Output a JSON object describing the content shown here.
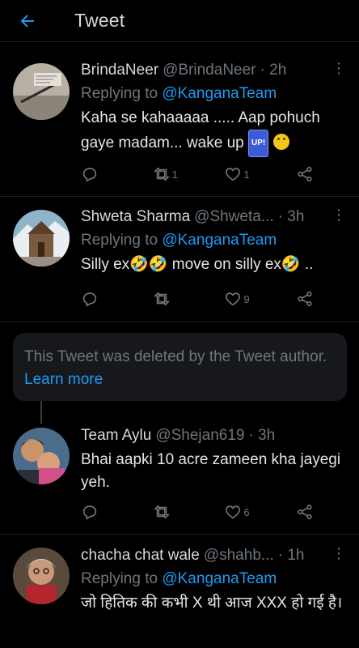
{
  "header": {
    "title": "Tweet"
  },
  "tweets": [
    {
      "name": "BrindaNeer",
      "handle": "@BrindaNeer",
      "time": "· 2h",
      "replying_prefix": "Replying to ",
      "replying_handle": "@KanganaTeam",
      "text": "Kaha se kahaaaaa ..... Aap pohuch gaye madam... wake up",
      "emoji_up": "UP!",
      "reply_count": "",
      "retweet_count": "1",
      "like_count": "1"
    },
    {
      "name": "Shweta Sharma",
      "handle": "@Shweta...",
      "time": "· 3h",
      "replying_prefix": "Replying to ",
      "replying_handle": "@KanganaTeam",
      "text": "Silly ex🤣🤣  move on silly ex🤣 ..",
      "reply_count": "",
      "retweet_count": "",
      "like_count": "9"
    },
    {
      "name": "Team Aylu",
      "handle": "@Shejan619",
      "time": "· 3h",
      "text": "Bhai aapki 10 acre zameen kha jayegi yeh.",
      "reply_count": "",
      "retweet_count": "",
      "like_count": "6"
    },
    {
      "name": "chacha chat wale",
      "handle": "@shahb...",
      "time": "· 1h",
      "replying_prefix": "Replying to ",
      "replying_handle": "@KanganaTeam",
      "text": "जो हितिक की कभी X थी आज XXX हो गई है।"
    }
  ],
  "deleted": {
    "text": "This Tweet was deleted by the Tweet author.",
    "link": "Learn more"
  },
  "icons": {
    "back": "arrow-left-icon",
    "more": "more-vertical-icon",
    "reply": "reply-icon",
    "retweet": "retweet-icon",
    "like": "heart-icon",
    "share": "share-icon"
  },
  "colors": {
    "background": "#000000",
    "accent": "#1d9bf0",
    "muted": "#6e767d",
    "text": "#d9d9d9"
  }
}
